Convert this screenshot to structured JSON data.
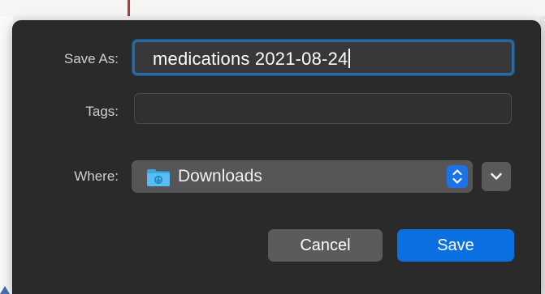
{
  "dialog": {
    "save_as_label": "Save As:",
    "filename_value": "medications 2021-08-24",
    "tags_label": "Tags:",
    "tags_value": "",
    "where_label": "Where:",
    "where_value": "Downloads",
    "cancel_label": "Cancel",
    "save_label": "Save"
  },
  "icons": {
    "folder": "downloads-folder-icon",
    "stepper": "up-down-chevron-icon",
    "disclosure": "chevron-down-icon"
  },
  "colors": {
    "dialog_bg": "#2a2a2b",
    "accent": "#0a6fe0",
    "focus_ring": "#2a6aa3",
    "field_bg": "#38383a",
    "button_bg": "#5b5b5d"
  }
}
